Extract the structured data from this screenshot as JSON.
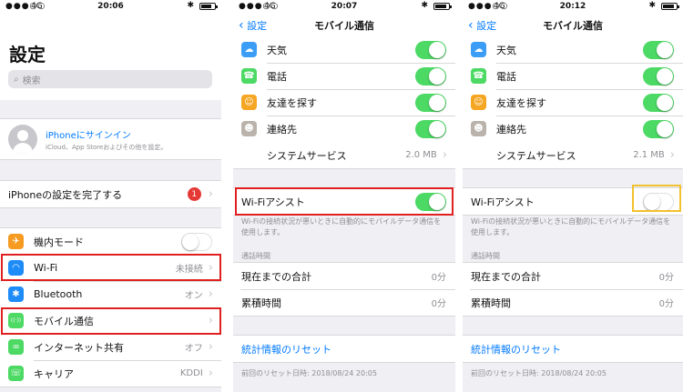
{
  "panel1": {
    "status": {
      "signal": "●●●○○",
      "network": "4G",
      "time": "20:06",
      "bluetooth": "✱",
      "battery_level": 0.8
    },
    "title": "設定",
    "search_placeholder": "検索",
    "profile": {
      "name": "iPhoneにサインイン",
      "sub": "iCloud、App Storeおよびその他を設定。"
    },
    "setup": {
      "label": "iPhoneの設定を完了する",
      "badge": "1"
    },
    "items": [
      {
        "label": "機内モード",
        "value": "",
        "icon": "airplane-icon",
        "color": "#f59b22",
        "glyph": "✈",
        "toggle": "off"
      },
      {
        "label": "Wi-Fi",
        "value": "未接続",
        "icon": "wifi-icon",
        "color": "#1d8bf8",
        "glyph": "◠",
        "toggle": ""
      },
      {
        "label": "Bluetooth",
        "value": "オン",
        "icon": "bluetooth-icon",
        "color": "#1d8bf8",
        "glyph": "✱",
        "toggle": ""
      },
      {
        "label": "モバイル通信",
        "value": "",
        "icon": "cellular-icon",
        "color": "#4cd964",
        "glyph": "((·))",
        "toggle": ""
      },
      {
        "label": "インターネット共有",
        "value": "オフ",
        "icon": "hotspot-icon",
        "color": "#4cd964",
        "glyph": "∞",
        "toggle": ""
      },
      {
        "label": "キャリア",
        "value": "KDDI",
        "icon": "carrier-icon",
        "color": "#4cd964",
        "glyph": "☏",
        "toggle": ""
      }
    ]
  },
  "panel2": {
    "status": {
      "signal": "●●●○○",
      "network": "4G",
      "time": "20:07",
      "bluetooth": "✱",
      "battery_level": 0.85
    },
    "back": "設定",
    "title": "モバイル通信",
    "apps": [
      {
        "label": "天気",
        "icon": "weather-icon",
        "color": "#3b9df5",
        "glyph": "☁"
      },
      {
        "label": "電話",
        "icon": "phone-icon",
        "color": "#4cd964",
        "glyph": "☎"
      },
      {
        "label": "友達を探す",
        "icon": "find-friends-icon",
        "color": "#f5a623",
        "glyph": "☺"
      },
      {
        "label": "連絡先",
        "icon": "contacts-icon",
        "color": "#b9b3ab",
        "glyph": "☻"
      }
    ],
    "system": {
      "label": "システムサービス",
      "value": "2.0 MB"
    },
    "wifi_assist": {
      "label": "Wi-Fiアシスト",
      "state": "on"
    },
    "wifi_desc": "Wi-Fiの接続状況が悪いときに自動的にモバイルデータ通信を使用します。",
    "call_header": "通話時間",
    "current": {
      "label": "現在までの合計",
      "value": "0分"
    },
    "cumulative": {
      "label": "累積時間",
      "value": "0分"
    },
    "reset": "統計情報のリセット",
    "last_reset": "前回のリセット日時: 2018/08/24 20:05"
  },
  "panel3": {
    "status": {
      "signal": "●●●○○",
      "network": "4G",
      "time": "20:12",
      "bluetooth": "✱",
      "battery_level": 0.85
    },
    "back": "設定",
    "title": "モバイル通信",
    "apps": [
      {
        "label": "天気",
        "icon": "weather-icon",
        "color": "#3b9df5",
        "glyph": "☁"
      },
      {
        "label": "電話",
        "icon": "phone-icon",
        "color": "#4cd964",
        "glyph": "☎"
      },
      {
        "label": "友達を探す",
        "icon": "find-friends-icon",
        "color": "#f5a623",
        "glyph": "☺"
      },
      {
        "label": "連絡先",
        "icon": "contacts-icon",
        "color": "#b9b3ab",
        "glyph": "☻"
      }
    ],
    "system": {
      "label": "システムサービス",
      "value": "2.1 MB"
    },
    "wifi_assist": {
      "label": "Wi-Fiアシスト",
      "state": "off"
    },
    "wifi_desc": "Wi-Fiの接続状況が悪いときに自動的にモバイルデータ通信を使用します。",
    "call_header": "通話時間",
    "current": {
      "label": "現在までの合計",
      "value": "0分"
    },
    "cumulative": {
      "label": "累積時間",
      "value": "0分"
    },
    "reset": "統計情報のリセット",
    "last_reset": "前回のリセット日時: 2018/08/24 20:05"
  },
  "colors": {
    "accent": "#007aff",
    "switch_on": "#4cd964",
    "highlight_red": "#e02020",
    "highlight_yellow": "#f2c12e",
    "badge": "#e53935"
  }
}
